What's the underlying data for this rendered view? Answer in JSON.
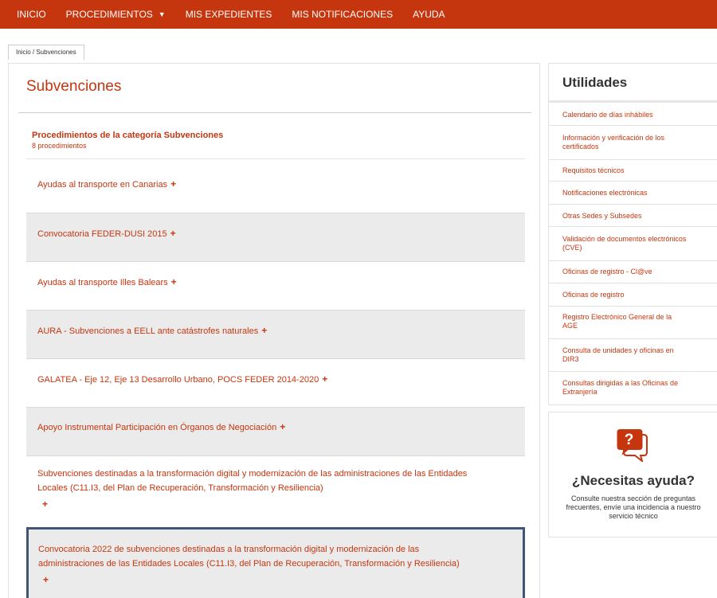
{
  "nav": {
    "items": [
      "INICIO",
      "PROCEDIMIENTOS",
      "MIS EXPEDIENTES",
      "MIS NOTIFICACIONES",
      "AYUDA"
    ],
    "caret": "▼"
  },
  "breadcrumb": "Inicio / Subvenciones",
  "main": {
    "title": "Subvenciones",
    "category_title": "Procedimientos de la categoría Subvenciones",
    "category_count": "8 procedimientos",
    "plus": "+",
    "procedures": [
      {
        "lines": [
          "Ayudas al transporte en Canarias"
        ]
      },
      {
        "lines": [
          "Convocatoria FEDER-DUSI 2015"
        ]
      },
      {
        "lines": [
          "Ayudas al transporte Illes Balears"
        ]
      },
      {
        "lines": [
          "AURA - Subvenciones a EELL ante catástrofes naturales"
        ]
      },
      {
        "lines": [
          "GALATEA - Eje 12, Eje 13 Desarrollo Urbano, POCS FEDER 2014-2020"
        ]
      },
      {
        "lines": [
          "Apoyo Instrumental Participación en Órganos de Negociación"
        ]
      },
      {
        "lines": [
          "Subvenciones destinadas a la transformación digital y modernización de las administraciones de las Entidades",
          "Locales (C11.I3, del Plan de Recuperación, Transformación y Resiliencia)"
        ]
      },
      {
        "lines": [
          "Convocatoria 2022 de subvenciones destinadas a la transformación digital y modernización de las",
          "administraciones de las Entidades Locales (C11.I3, del Plan de Recuperación, Transformación y Resiliencia)"
        ]
      }
    ]
  },
  "side": {
    "title": "Utilidades",
    "links": [
      [
        "Calendario de días inhábiles"
      ],
      [
        "Información y verificación de los",
        "certificados"
      ],
      [
        "Requisitos técnicos"
      ],
      [
        "Notificaciones electrónicas"
      ],
      [
        "Otras Sedes y Subsedes"
      ],
      [
        "Validación de documentos electrónicos",
        "(CVE)"
      ],
      [
        "Oficinas de registro - Cl@ve"
      ],
      [
        "Oficinas de registro"
      ],
      [
        "Registro Electrónico General de la",
        "AGE"
      ],
      [
        "Consulta de unidades y oficinas en",
        "DIR3"
      ],
      [
        "Consultas dirigidas a las Oficinas de",
        "Extranjería"
      ]
    ]
  },
  "help": {
    "icon": "help-chat-icon",
    "icon_glyph": "?",
    "title": "¿Necesitas ayuda?",
    "lines": [
      "Consulte nuestra sección de preguntas",
      "frecuentes, envíe una incidencia a nuestro",
      "servicio técnico"
    ]
  },
  "colors": {
    "accent": "#c5360f",
    "selected_border": "#3f5573",
    "row_grey": "#ebebeb"
  }
}
